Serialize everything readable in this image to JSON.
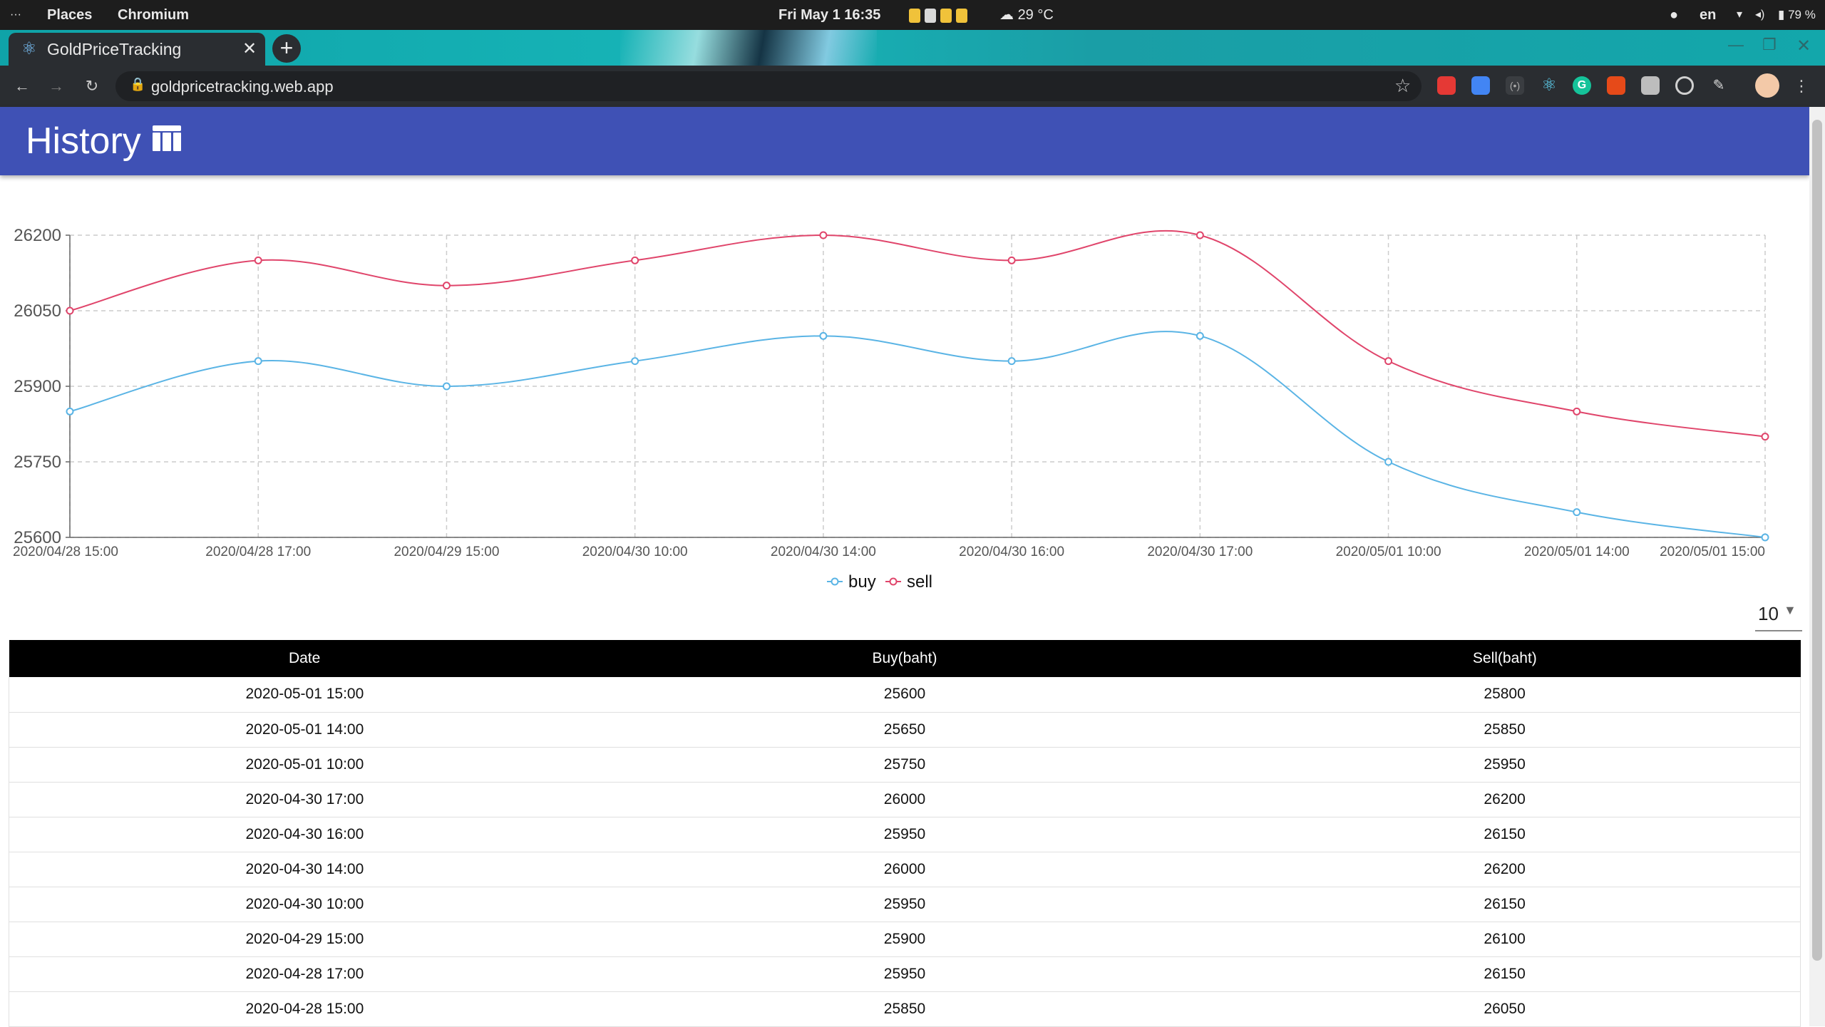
{
  "system": {
    "activities": "···",
    "places": "Places",
    "app_name": "Chromium",
    "datetime": "Fri May 1  16:35",
    "weather": "29 °C",
    "lang": "en",
    "battery": "79 %"
  },
  "browser": {
    "tab_title": "GoldPriceTracking",
    "url": "goldpricetracking.web.app"
  },
  "header": {
    "title": "History"
  },
  "page_size": {
    "value": "10"
  },
  "table": {
    "columns": [
      "Date",
      "Buy(baht)",
      "Sell(baht)"
    ],
    "rows": [
      [
        "2020-05-01 15:00",
        "25600",
        "25800"
      ],
      [
        "2020-05-01 14:00",
        "25650",
        "25850"
      ],
      [
        "2020-05-01 10:00",
        "25750",
        "25950"
      ],
      [
        "2020-04-30 17:00",
        "26000",
        "26200"
      ],
      [
        "2020-04-30 16:00",
        "25950",
        "26150"
      ],
      [
        "2020-04-30 14:00",
        "26000",
        "26200"
      ],
      [
        "2020-04-30 10:00",
        "25950",
        "26150"
      ],
      [
        "2020-04-29 15:00",
        "25900",
        "26100"
      ],
      [
        "2020-04-28 17:00",
        "25950",
        "26150"
      ],
      [
        "2020-04-28 15:00",
        "25850",
        "26050"
      ]
    ]
  },
  "chart_data": {
    "type": "line",
    "title": "",
    "xlabel": "",
    "ylabel": "",
    "categories": [
      "2020/04/28 15:00",
      "2020/04/28 17:00",
      "2020/04/29 15:00",
      "2020/04/30 10:00",
      "2020/04/30 14:00",
      "2020/04/30 16:00",
      "2020/04/30 17:00",
      "2020/05/01 10:00",
      "2020/05/01 14:00",
      "2020/05/01 15:00"
    ],
    "series": [
      {
        "name": "buy",
        "color": "#5ab4e5",
        "values": [
          25850,
          25950,
          25900,
          25950,
          26000,
          25950,
          26000,
          25750,
          25650,
          25600
        ]
      },
      {
        "name": "sell",
        "color": "#e0456b",
        "values": [
          26050,
          26150,
          26100,
          26150,
          26200,
          26150,
          26200,
          25950,
          25850,
          25800
        ]
      }
    ],
    "y_ticks": [
      25600,
      25750,
      25900,
      26050,
      26200
    ],
    "ylim": [
      25600,
      26200
    ],
    "grid": true,
    "legend_position": "bottom-center"
  }
}
